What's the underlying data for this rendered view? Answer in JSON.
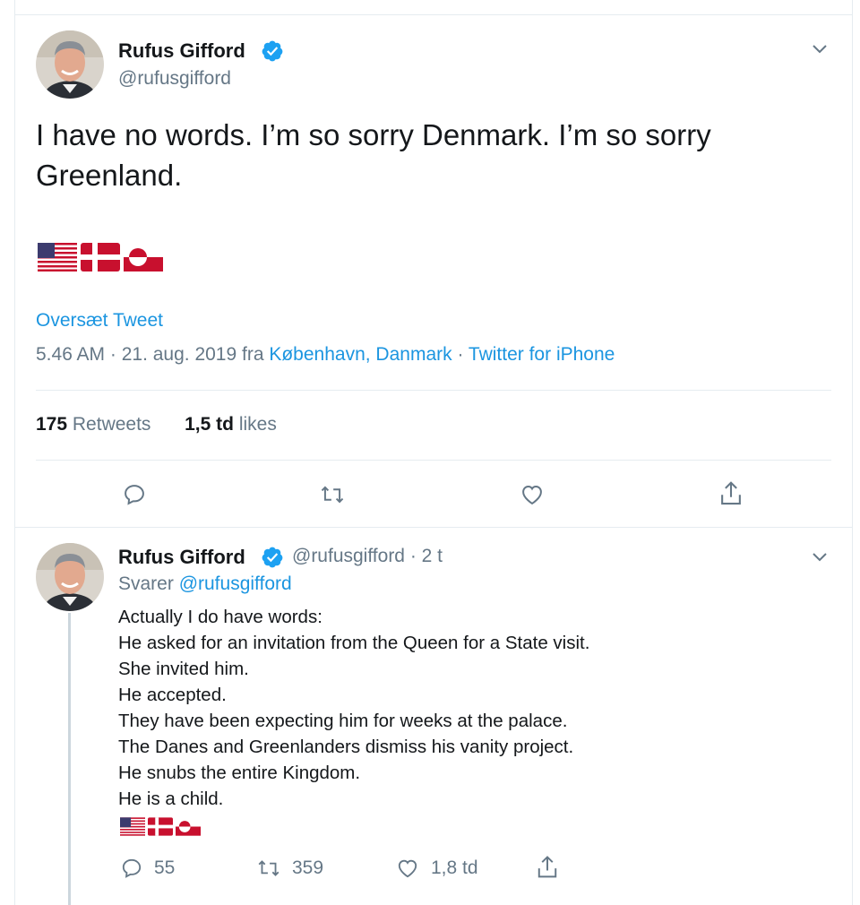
{
  "tweet": {
    "author_name": "Rufus Gifford",
    "handle": "@rufusgifford",
    "text": "I have no words. I’m so sorry Denmark. I’m so sorry Greenland.",
    "flags": [
      "us-flag",
      "denmark-flag",
      "greenland-flag"
    ],
    "translate_label": "Oversæt Tweet",
    "timestamp": "5.46 AM · 21. aug. 2019 fra ",
    "location": "København, Danmark",
    "separator": " · ",
    "source": "Twitter for iPhone",
    "retweets_count": "175",
    "retweets_label": "Retweets",
    "likes_count": "1,5 td",
    "likes_label": "likes",
    "actions": [
      "reply-icon",
      "retweet-icon",
      "like-icon",
      "share-icon"
    ]
  },
  "reply": {
    "author_name": "Rufus Gifford",
    "handle_time": "@rufusgifford · 2 t",
    "replying_prefix": "Svarer ",
    "replying_to": "@rufusgifford",
    "lines": [
      "Actually I do have words:",
      "He asked for an invitation from the Queen for a State visit.",
      "She invited him.",
      "He accepted.",
      "They have been expecting him for weeks at the palace.",
      "The Danes and Greenlanders dismiss his vanity project.",
      "He snubs the entire Kingdom.",
      "He is a child."
    ],
    "flags": [
      "us-flag",
      "denmark-flag",
      "greenland-flag"
    ],
    "reply_count": "55",
    "retweet_count": "359",
    "like_count": "1,8 td"
  },
  "colors": {
    "link": "#1b95e0",
    "secondary_text": "#657786",
    "divider": "#e6ecf0",
    "verified": "#1da1f2"
  }
}
